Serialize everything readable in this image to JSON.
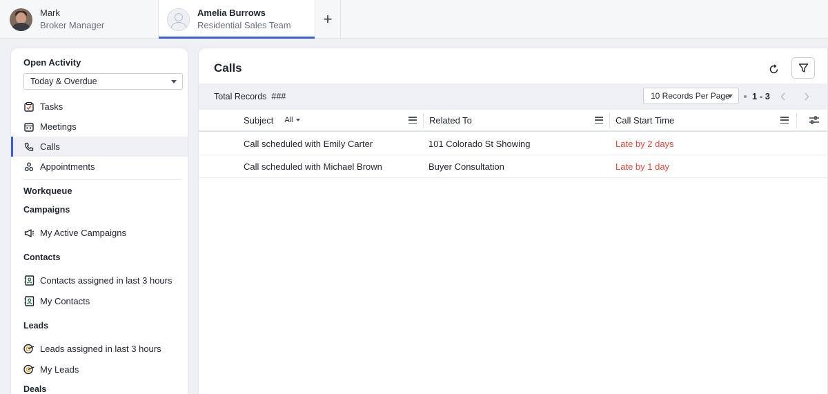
{
  "tabs": {
    "current_user": {
      "name": "Mark",
      "role": "Broker Manager"
    },
    "viewing_user": {
      "name": "Amelia Burrows",
      "role": "Residential Sales Team"
    },
    "add_label": "+"
  },
  "sidebar": {
    "open_activity_heading": "Open Activity",
    "filter_value": "Today & Overdue",
    "activity_items": [
      {
        "label": "Tasks",
        "icon": "task-check-icon",
        "active": false
      },
      {
        "label": "Meetings",
        "icon": "calendar-icon",
        "active": false
      },
      {
        "label": "Calls",
        "icon": "phone-icon",
        "active": true
      },
      {
        "label": "Appointments",
        "icon": "appointment-icon",
        "active": false
      }
    ],
    "workqueue_heading": "Workqueue",
    "campaigns_heading": "Campaigns",
    "campaign_items": [
      {
        "label": "My Active Campaigns",
        "icon": "megaphone-icon"
      }
    ],
    "contacts_heading": "Contacts",
    "contact_items": [
      {
        "label": "Contacts assigned in last 3 hours",
        "icon": "contact-card-icon"
      },
      {
        "label": "My Contacts",
        "icon": "contact-card-icon"
      }
    ],
    "leads_heading": "Leads",
    "lead_items": [
      {
        "label": "Leads assigned in last 3 hours",
        "icon": "target-icon"
      },
      {
        "label": "My Leads",
        "icon": "target-icon"
      }
    ],
    "deals_heading": "Deals"
  },
  "main": {
    "title": "Calls",
    "total_records_label": "Total Records",
    "total_records_value": "###",
    "per_page": "10 Records Per Page",
    "range": "1 - 3",
    "columns": {
      "subject": "Subject",
      "subject_filter": "All",
      "related_to": "Related To",
      "call_start_time": "Call Start Time"
    },
    "rows": [
      {
        "subject": "Call scheduled with Emily Carter",
        "related_to": "101 Colorado St Showing",
        "call_start_time": "Late by 2 days"
      },
      {
        "subject": "Call scheduled with Michael Brown",
        "related_to": "Buyer Consultation",
        "call_start_time": "Late by 1 day"
      }
    ]
  },
  "colors": {
    "accent": "#3d5be0",
    "late": "#e5483a",
    "page_bg": "#eef0f4"
  }
}
